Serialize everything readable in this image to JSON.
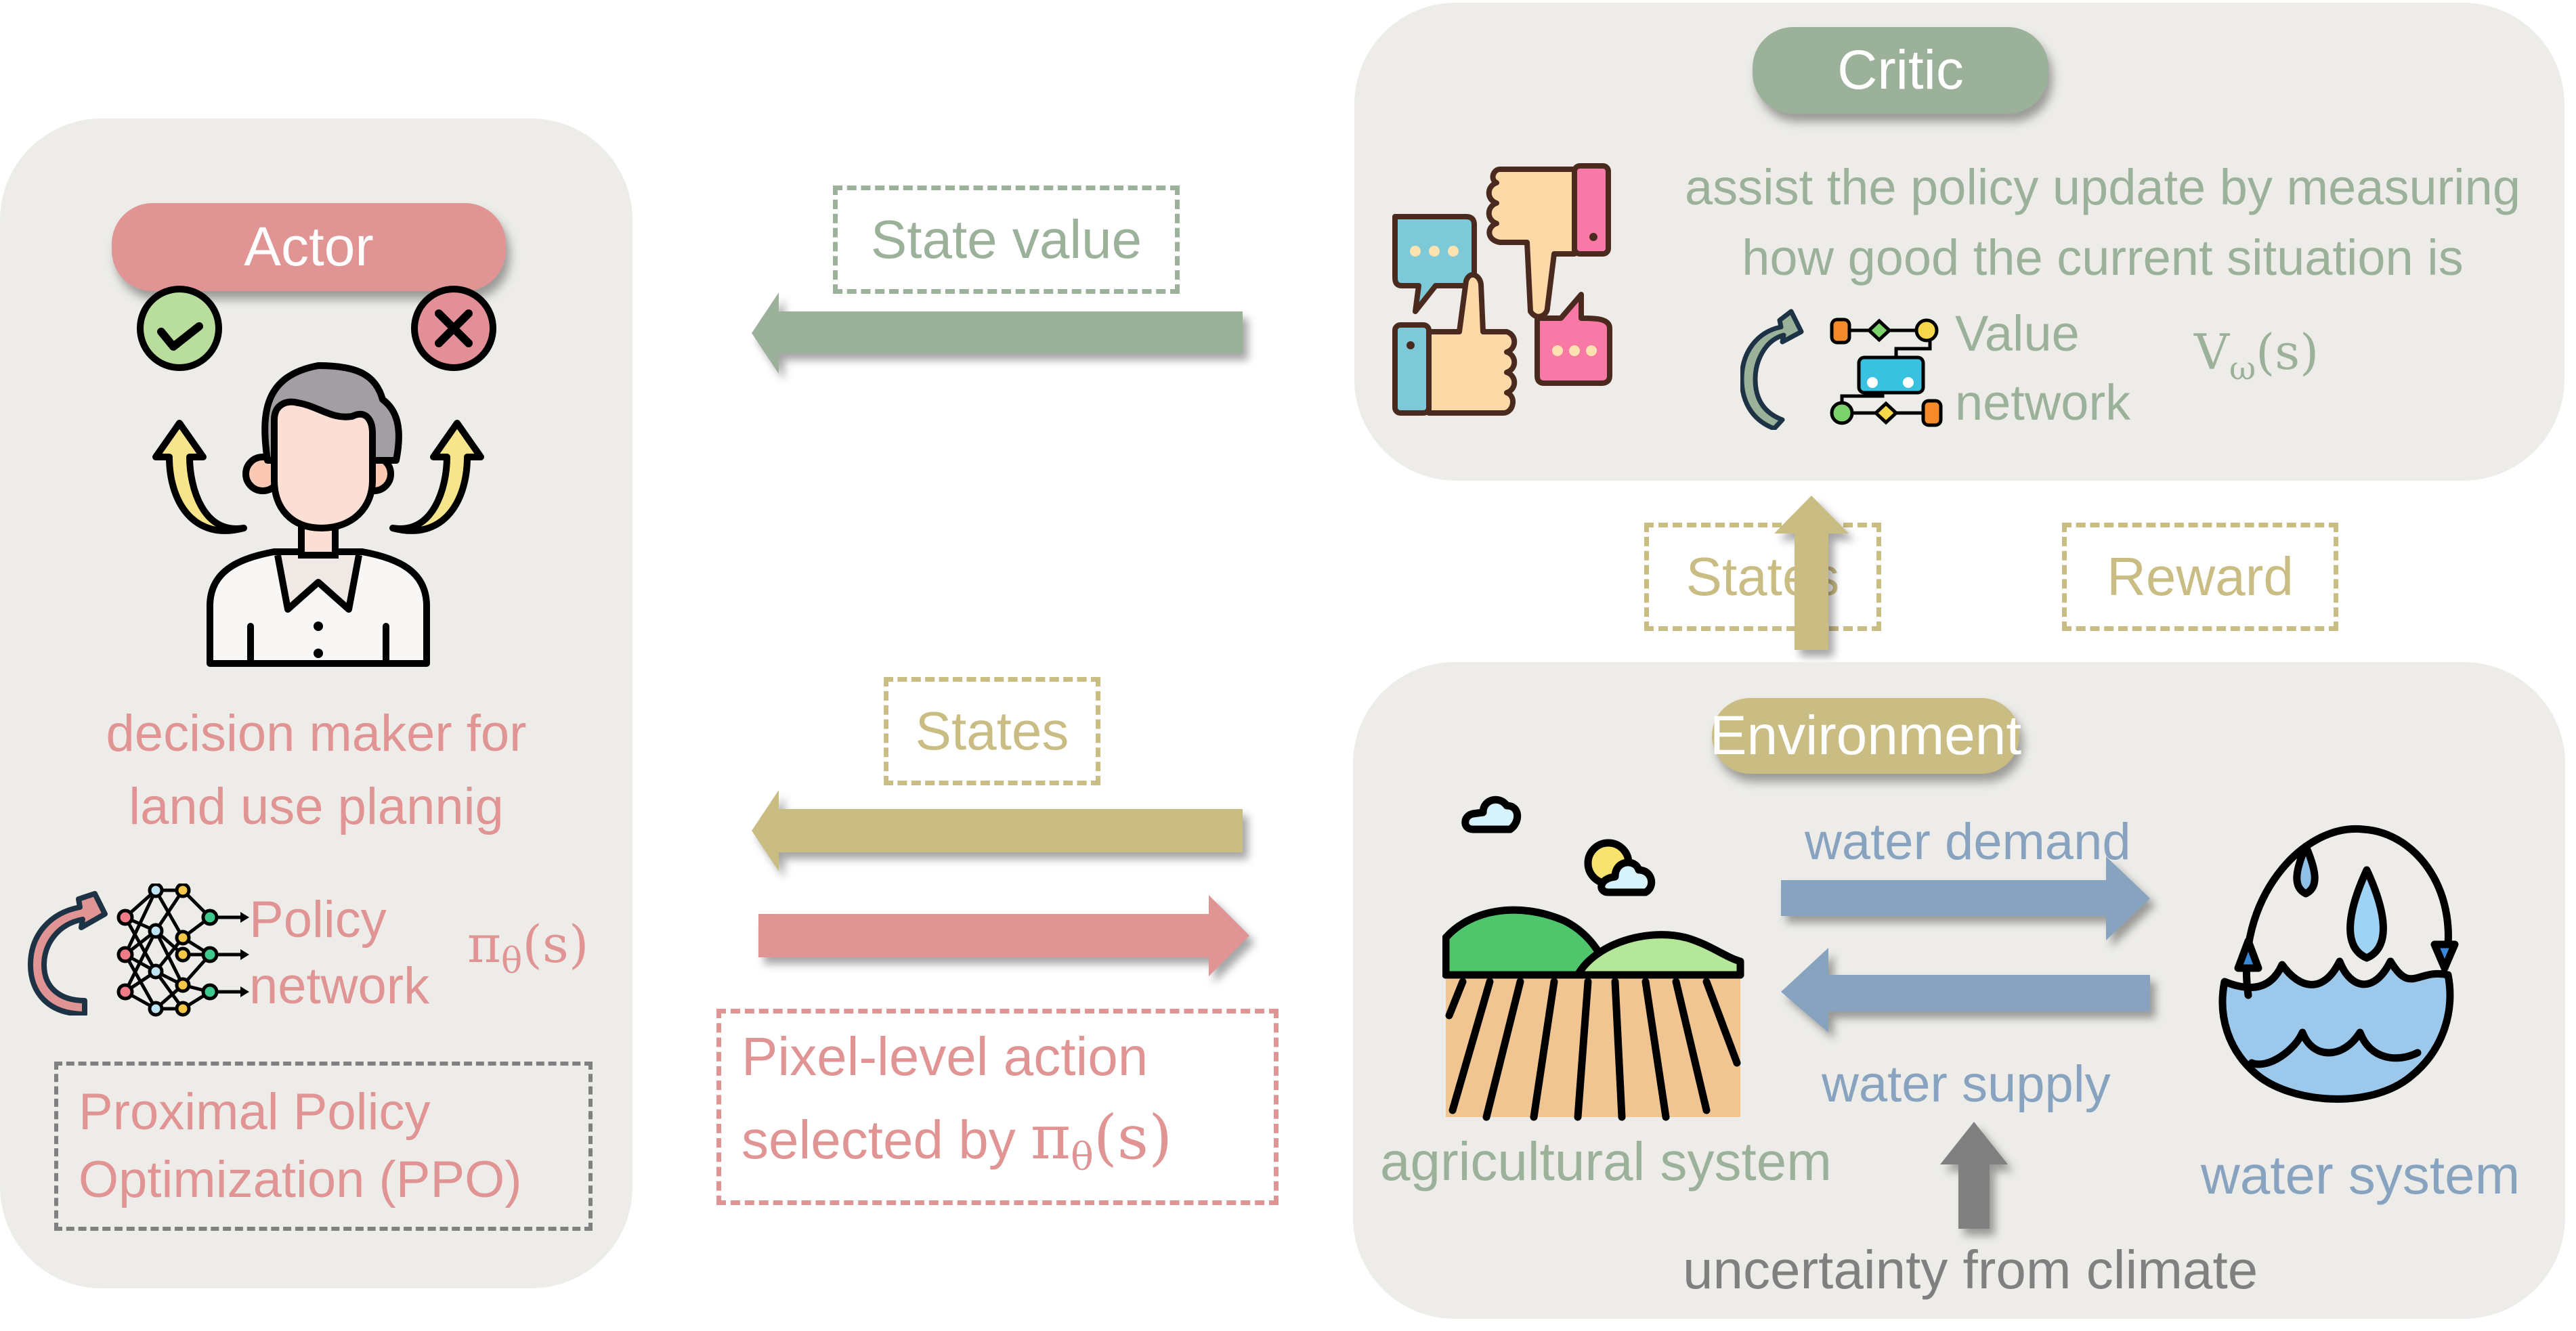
{
  "colors": {
    "actor": "#e09494",
    "critic": "#9cb19a",
    "environment": "#cabd84",
    "water": "#87a3c0",
    "climate": "#808080",
    "panel_bg": "#edece8"
  },
  "actor": {
    "title": "Actor",
    "description_line1": "decision maker for",
    "description_line2": "land use plannig",
    "network_line1": "Policy",
    "network_line2": "network",
    "policy_symbol": "π",
    "policy_subscript": "θ",
    "policy_arg": "(s)",
    "algorithm_line1": "Proximal Policy",
    "algorithm_line2": "Optimization (PPO)",
    "icons": [
      "decision-maker-person-icon",
      "check-icon",
      "cross-icon",
      "neural-network-icon",
      "update-cycle-arrow-icon"
    ]
  },
  "critic": {
    "title": "Critic",
    "description_line1": "assist the policy update by measuring",
    "description_line2": "how good the current situation is",
    "network_line1": "Value",
    "network_line2": "network",
    "value_symbol": "V",
    "value_subscript": "ω",
    "value_arg": "(s)",
    "icons": [
      "thumbs-feedback-icon",
      "value-network-icon",
      "update-cycle-arrow-icon"
    ]
  },
  "environment": {
    "title": "Environment",
    "agricultural_label": "agricultural system",
    "water_label": "water system",
    "demand_label": "water demand",
    "supply_label": "water supply",
    "climate_label": "uncertainty from climate",
    "icons": [
      "farmland-icon",
      "water-cycle-icon"
    ]
  },
  "flows": {
    "state_value_label": "State value",
    "states_to_actor_label": "States",
    "action_label_line1": "Pixel-level action",
    "action_label_line2_prefix": "selected by ",
    "action_symbol": "π",
    "action_subscript": "θ",
    "action_arg": "(s)",
    "states_to_critic_label": "States",
    "reward_label": "Reward"
  }
}
